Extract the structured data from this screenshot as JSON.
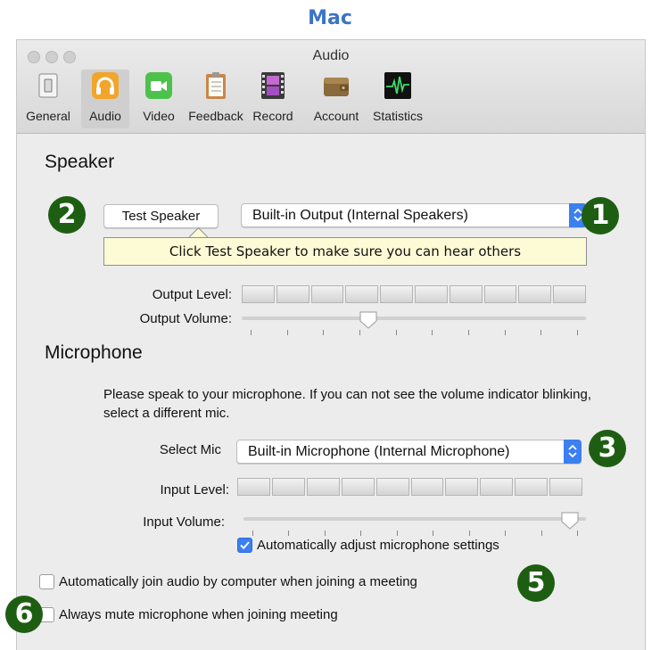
{
  "caption": "Mac",
  "window": {
    "title": "Audio",
    "toolbar": [
      {
        "id": "general",
        "label": "General",
        "icon": "switch-icon"
      },
      {
        "id": "audio",
        "label": "Audio",
        "icon": "headphones-icon",
        "active": true
      },
      {
        "id": "video",
        "label": "Video",
        "icon": "video-camera-icon"
      },
      {
        "id": "feedback",
        "label": "Feedback",
        "icon": "clipboard-icon"
      },
      {
        "id": "record",
        "label": "Record",
        "icon": "film-icon"
      },
      {
        "id": "account",
        "label": "Account",
        "icon": "wallet-icon"
      },
      {
        "id": "statistics",
        "label": "Statistics",
        "icon": "waveform-icon"
      }
    ]
  },
  "speaker": {
    "heading": "Speaker",
    "test_button": "Test Speaker",
    "output_device": "Built-in Output (Internal Speakers)",
    "tooltip": "Click Test Speaker to make sure you can hear others",
    "output_level_label": "Output Level:",
    "output_volume_label": "Output Volume:",
    "output_volume_value": 0.36,
    "meter_segments": 10
  },
  "microphone": {
    "heading": "Microphone",
    "instructions": "Please speak to your microphone. If you can not see the volume indicator blinking, select a different mic.",
    "select_mic_label": "Select Mic",
    "mic_device": "Built-in Microphone (Internal Microphone)",
    "input_level_label": "Input Level:",
    "input_volume_label": "Input Volume:",
    "input_volume_value": 0.98,
    "meter_segments": 10,
    "auto_adjust_label": "Automatically adjust microphone settings",
    "auto_adjust_checked": true
  },
  "options": {
    "auto_join_label": "Automatically join audio by computer when joining a meeting",
    "auto_join_checked": false,
    "mute_label": "Always mute microphone when joining meeting",
    "mute_checked": false
  },
  "badges": [
    "1",
    "2",
    "3",
    "5",
    "6"
  ],
  "colors": {
    "accent_blue": "#3b7ff0",
    "badge_green": "#1e5e12",
    "caption_blue": "#3b74c4",
    "tooltip_bg": "#fdfbd5"
  }
}
